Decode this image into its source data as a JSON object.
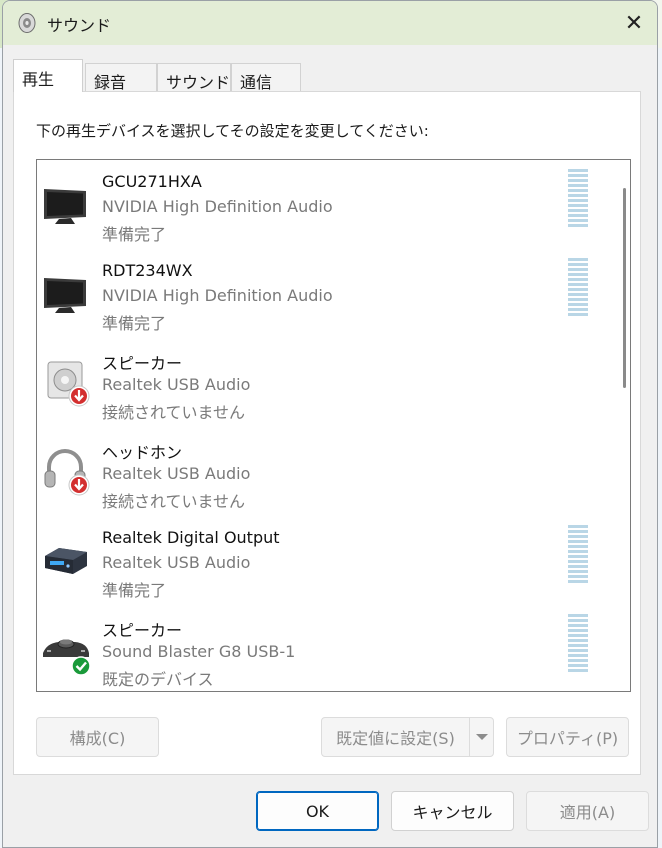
{
  "window": {
    "title": "サウンド",
    "close_label": "✕"
  },
  "tabs": [
    {
      "label": "再生",
      "active": true
    },
    {
      "label": "録音",
      "active": false
    },
    {
      "label": "サウンド",
      "active": false
    },
    {
      "label": "通信",
      "active": false
    }
  ],
  "instruction": "下の再生デバイスを選択してその設定を変更してください:",
  "devices": [
    {
      "name": "GCU271HXA",
      "driver": "NVIDIA High Definition Audio",
      "status": "準備完了",
      "icon": "monitor-icon",
      "meter": true
    },
    {
      "name": "RDT234WX",
      "driver": "NVIDIA High Definition Audio",
      "status": "準備完了",
      "icon": "monitor-icon",
      "meter": true
    },
    {
      "name": "スピーカー",
      "driver": "Realtek USB Audio",
      "status": "接続されていません",
      "icon": "speaker-disconnected-icon",
      "meter": false
    },
    {
      "name": "ヘッドホン",
      "driver": "Realtek USB Audio",
      "status": "接続されていません",
      "icon": "headphones-disconnected-icon",
      "meter": false
    },
    {
      "name": "Realtek Digital Output",
      "driver": "Realtek USB Audio",
      "status": "準備完了",
      "icon": "digital-output-icon",
      "meter": true
    },
    {
      "name": "スピーカー",
      "driver": "Sound Blaster G8 USB-1",
      "status": "既定のデバイス",
      "icon": "sound-blaster-default-icon",
      "meter": true
    }
  ],
  "buttons": {
    "configure": "構成(C)",
    "set_default": "既定値に設定(S)",
    "properties": "プロパティ(P)",
    "ok": "OK",
    "cancel": "キャンセル",
    "apply": "適用(A)"
  },
  "colors": {
    "accent": "#0067c0",
    "meter": "#b9d6e6",
    "disconnected": "#d32f2f",
    "default_check": "#1a9a3a"
  }
}
